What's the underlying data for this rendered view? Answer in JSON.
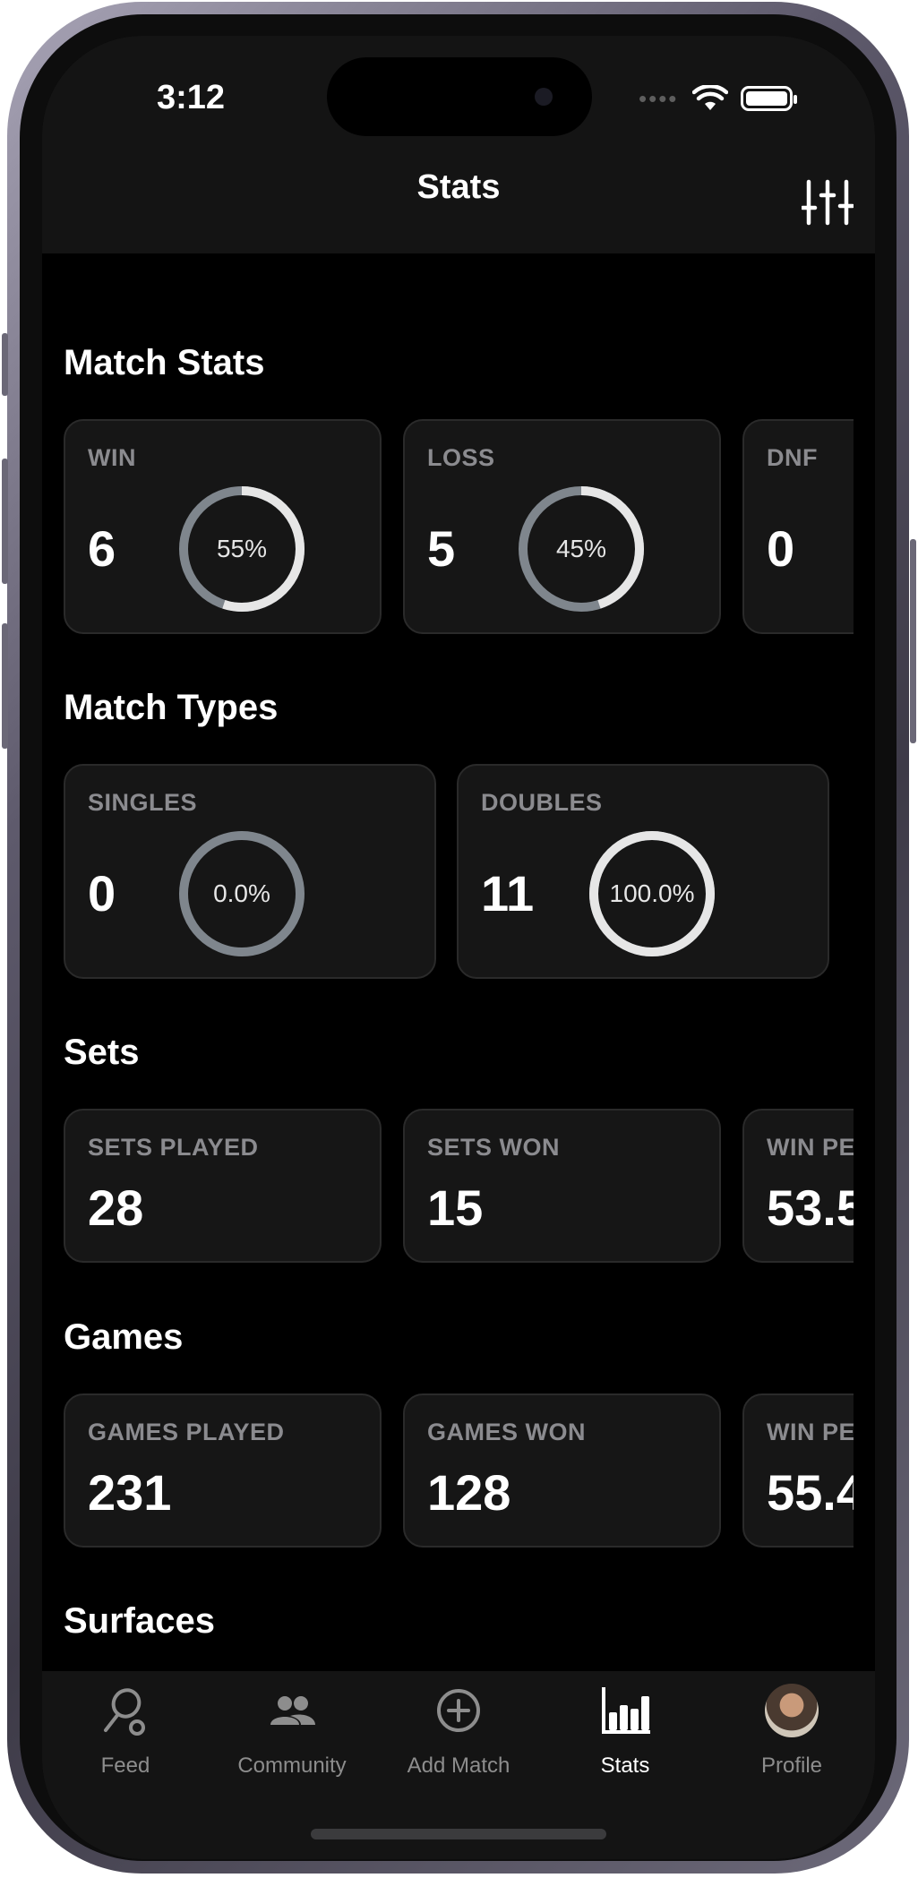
{
  "status_bar": {
    "time": "3:12"
  },
  "header": {
    "title": "Stats",
    "filter_icon": "sliders-icon"
  },
  "sections": {
    "match_stats": {
      "title": "Match Stats",
      "cards": [
        {
          "label": "WIN",
          "value": "6",
          "percent_text": "55%",
          "percent": 55
        },
        {
          "label": "LOSS",
          "value": "5",
          "percent_text": "45%",
          "percent": 45
        },
        {
          "label": "DNF",
          "value": "0"
        }
      ]
    },
    "match_types": {
      "title": "Match Types",
      "cards": [
        {
          "label": "SINGLES",
          "value": "0",
          "percent_text": "0.0%",
          "percent": 0
        },
        {
          "label": "DOUBLES",
          "value": "11",
          "percent_text": "100.0%",
          "percent": 100
        }
      ]
    },
    "sets": {
      "title": "Sets",
      "cards": [
        {
          "label": "SETS PLAYED",
          "value": "28"
        },
        {
          "label": "SETS WON",
          "value": "15"
        },
        {
          "label": "WIN PE",
          "value": "53.5"
        }
      ]
    },
    "games": {
      "title": "Games",
      "cards": [
        {
          "label": "GAMES PLAYED",
          "value": "231"
        },
        {
          "label": "GAMES WON",
          "value": "128"
        },
        {
          "label": "WIN PE",
          "value": "55.4"
        }
      ]
    },
    "surfaces": {
      "title": "Surfaces"
    }
  },
  "tabs": [
    {
      "label": "Feed",
      "icon": "tennis-racket-icon"
    },
    {
      "label": "Community",
      "icon": "people-icon"
    },
    {
      "label": "Add Match",
      "icon": "plus-circle-icon"
    },
    {
      "label": "Stats",
      "icon": "bar-chart-icon",
      "active": true
    },
    {
      "label": "Profile",
      "icon": "avatar"
    }
  ],
  "colors": {
    "background": "#000000",
    "card": "#161616",
    "ring_track": "#7f868d",
    "ring_fill": "#e6e6e6",
    "label": "#8b8b8f"
  }
}
